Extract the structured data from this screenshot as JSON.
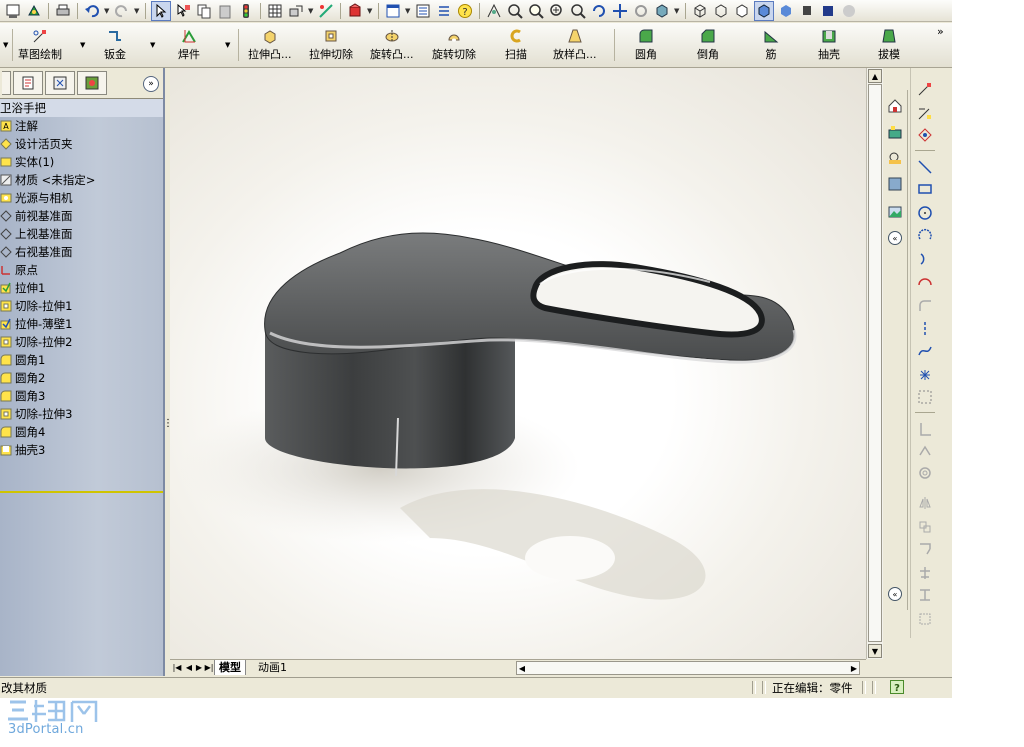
{
  "app": {
    "accent": "#3168d5"
  },
  "command_manager": {
    "sketch": "草图绘制",
    "sheetmetal": "钣金",
    "weldments": "焊件",
    "extruded_boss": "拉伸凸...",
    "extruded_cut": "拉伸切除",
    "revolved_boss": "旋转凸...",
    "revolved_cut": "旋转切除",
    "sweep": "扫描",
    "loft_boss": "放样凸...",
    "fillet": "圆角",
    "chamfer": "倒角",
    "rib": "筋",
    "shell": "抽壳",
    "draft": "拔模"
  },
  "feature_tree": {
    "root": "卫浴手把",
    "items": [
      {
        "label": "注解",
        "icon": "annotation-icon"
      },
      {
        "label": "设计活页夹",
        "icon": "design-binder-icon"
      },
      {
        "label": "实体(1)",
        "icon": "solid-bodies-icon"
      },
      {
        "label": "材质 <未指定>",
        "icon": "material-icon"
      },
      {
        "label": "光源与相机",
        "icon": "lights-cameras-icon"
      },
      {
        "label": "前视基准面",
        "icon": "plane-icon"
      },
      {
        "label": "上视基准面",
        "icon": "plane-icon"
      },
      {
        "label": "右视基准面",
        "icon": "plane-icon"
      },
      {
        "label": "原点",
        "icon": "origin-icon"
      },
      {
        "label": "拉伸1",
        "icon": "extrude-icon"
      },
      {
        "label": "切除-拉伸1",
        "icon": "cut-extrude-icon"
      },
      {
        "label": "拉伸-薄壁1",
        "icon": "thin-extrude-icon"
      },
      {
        "label": "切除-拉伸2",
        "icon": "cut-extrude-icon"
      },
      {
        "label": "圆角1",
        "icon": "fillet-icon"
      },
      {
        "label": "圆角2",
        "icon": "fillet-icon"
      },
      {
        "label": "圆角3",
        "icon": "fillet-icon"
      },
      {
        "label": "切除-拉伸3",
        "icon": "cut-extrude-icon"
      },
      {
        "label": "圆角4",
        "icon": "fillet-icon"
      },
      {
        "label": "抽壳3",
        "icon": "shell-icon"
      }
    ]
  },
  "doc_tabs": {
    "model": "模型",
    "motion": "动画1"
  },
  "status": {
    "left": "改其材质",
    "right": "正在编辑：零件"
  },
  "watermark": {
    "site": "3dPortal.cn"
  },
  "colors": {
    "model_body": "#4a4c4d",
    "tree_bg": "#b6c0d0",
    "selection_highlight": "#3168d5"
  }
}
